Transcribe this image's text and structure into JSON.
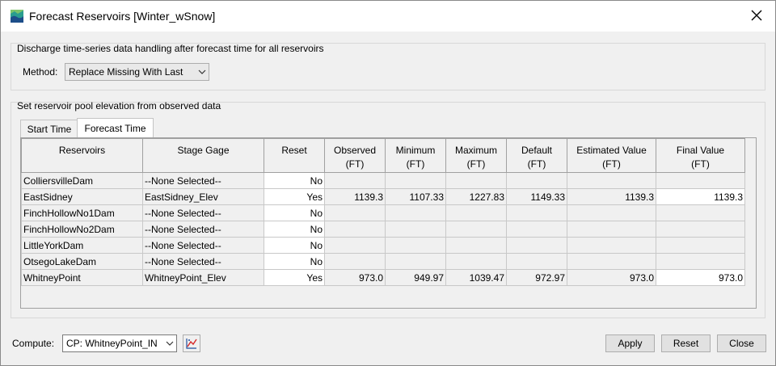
{
  "window": {
    "title": "Forecast Reservoirs [Winter_wSnow]"
  },
  "discharge": {
    "group_label": "Discharge time-series data handling after forecast time for all reservoirs",
    "method_label": "Method:",
    "method_value": "Replace Missing With Last"
  },
  "pool": {
    "group_label": "Set reservoir pool elevation from observed data",
    "tabs": [
      {
        "label": "Start Time",
        "active": false
      },
      {
        "label": "Forecast Time",
        "active": true
      }
    ]
  },
  "table": {
    "headers": [
      {
        "line1": "Reservoirs",
        "line2": ""
      },
      {
        "line1": "Stage Gage",
        "line2": ""
      },
      {
        "line1": "Reset",
        "line2": ""
      },
      {
        "line1": "Observed",
        "line2": "(FT)"
      },
      {
        "line1": "Minimum",
        "line2": "(FT)"
      },
      {
        "line1": "Maximum",
        "line2": "(FT)"
      },
      {
        "line1": "Default",
        "line2": "(FT)"
      },
      {
        "line1": "Estimated Value",
        "line2": "(FT)"
      },
      {
        "line1": "Final Value",
        "line2": "(FT)"
      }
    ],
    "rows": [
      {
        "reservoir": "ColliersvilleDam",
        "gage": "--None Selected--",
        "reset": "No",
        "observed": "",
        "minimum": "",
        "maximum": "",
        "default": "",
        "estimated": "",
        "final": ""
      },
      {
        "reservoir": "EastSidney",
        "gage": "EastSidney_Elev",
        "reset": "Yes",
        "observed": "1139.3",
        "minimum": "1107.33",
        "maximum": "1227.83",
        "default": "1149.33",
        "estimated": "1139.3",
        "final": "1139.3"
      },
      {
        "reservoir": "FinchHollowNo1Dam",
        "gage": "--None Selected--",
        "reset": "No",
        "observed": "",
        "minimum": "",
        "maximum": "",
        "default": "",
        "estimated": "",
        "final": ""
      },
      {
        "reservoir": "FinchHollowNo2Dam",
        "gage": "--None Selected--",
        "reset": "No",
        "observed": "",
        "minimum": "",
        "maximum": "",
        "default": "",
        "estimated": "",
        "final": ""
      },
      {
        "reservoir": "LittleYorkDam",
        "gage": "--None Selected--",
        "reset": "No",
        "observed": "",
        "minimum": "",
        "maximum": "",
        "default": "",
        "estimated": "",
        "final": ""
      },
      {
        "reservoir": "OtsegoLakeDam",
        "gage": "--None Selected--",
        "reset": "No",
        "observed": "",
        "minimum": "",
        "maximum": "",
        "default": "",
        "estimated": "",
        "final": ""
      },
      {
        "reservoir": "WhitneyPoint",
        "gage": "WhitneyPoint_Elev",
        "reset": "Yes",
        "observed": "973.0",
        "minimum": "949.97",
        "maximum": "1039.47",
        "default": "972.97",
        "estimated": "973.0",
        "final": "973.0"
      }
    ]
  },
  "footer": {
    "compute_label": "Compute:",
    "compute_value": "CP: WhitneyPoint_IN",
    "apply_label": "Apply",
    "reset_label": "Reset",
    "close_label": "Close"
  },
  "icons": {
    "app": "reservoir-app-icon",
    "close": "close-icon",
    "dropdown": "chevron-down-icon",
    "compute_tool": "compute-chart-icon"
  }
}
